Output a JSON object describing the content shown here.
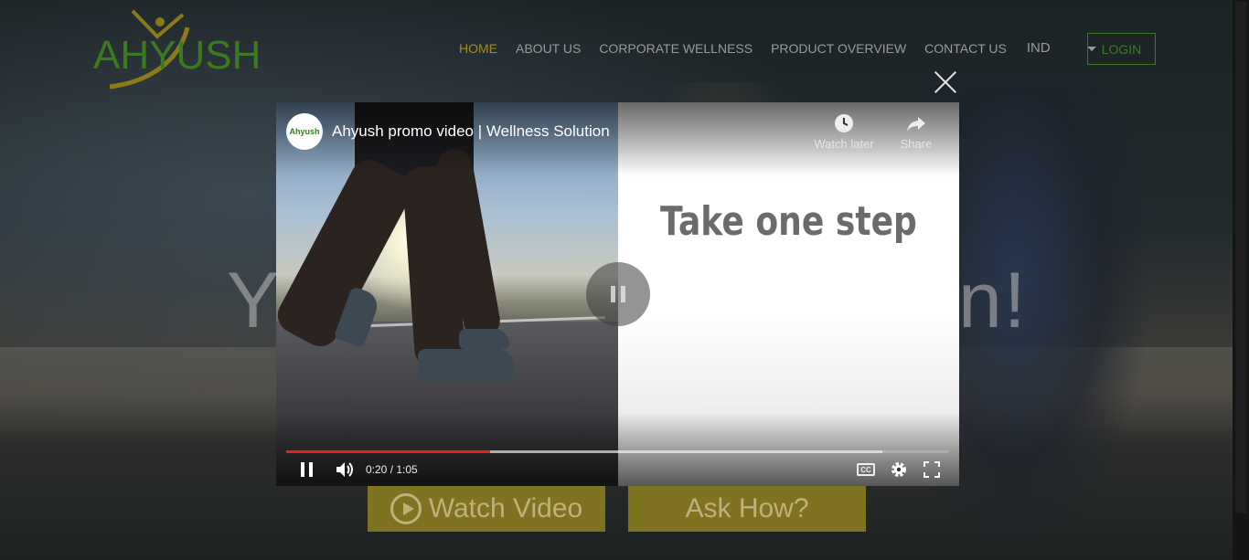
{
  "header": {
    "logo_text": "AHYUSH",
    "nav": [
      {
        "label": "HOME",
        "active": true
      },
      {
        "label": "ABOUT US",
        "active": false
      },
      {
        "label": "CORPORATE WELLNESS",
        "active": false
      },
      {
        "label": "PRODUCT OVERVIEW",
        "active": false
      },
      {
        "label": "CONTACT US",
        "active": false
      }
    ],
    "language": "IND",
    "login_label": "LOGIN"
  },
  "hero": {
    "headline_left": "Y",
    "headline_right": "n!",
    "watch_video_label": "Watch Video",
    "ask_how_label": "Ask How?"
  },
  "video": {
    "channel_avatar_text": "Ahyush",
    "title": "Ahyush promo video | Wellness Solution",
    "watch_later_label": "Watch later",
    "share_label": "Share",
    "frame_text": "Take one step",
    "time_current": "0:20",
    "time_total": "1:05",
    "time_display": "0:20 / 1:05",
    "progress_played_fraction": 0.308,
    "progress_buffered_fraction": 0.9,
    "cc_label": "CC"
  },
  "colors": {
    "nav_active": "#a58d1f",
    "brand_green": "#3c7a28",
    "progress_red": "#e62117",
    "hero_button": "#7e7320"
  }
}
